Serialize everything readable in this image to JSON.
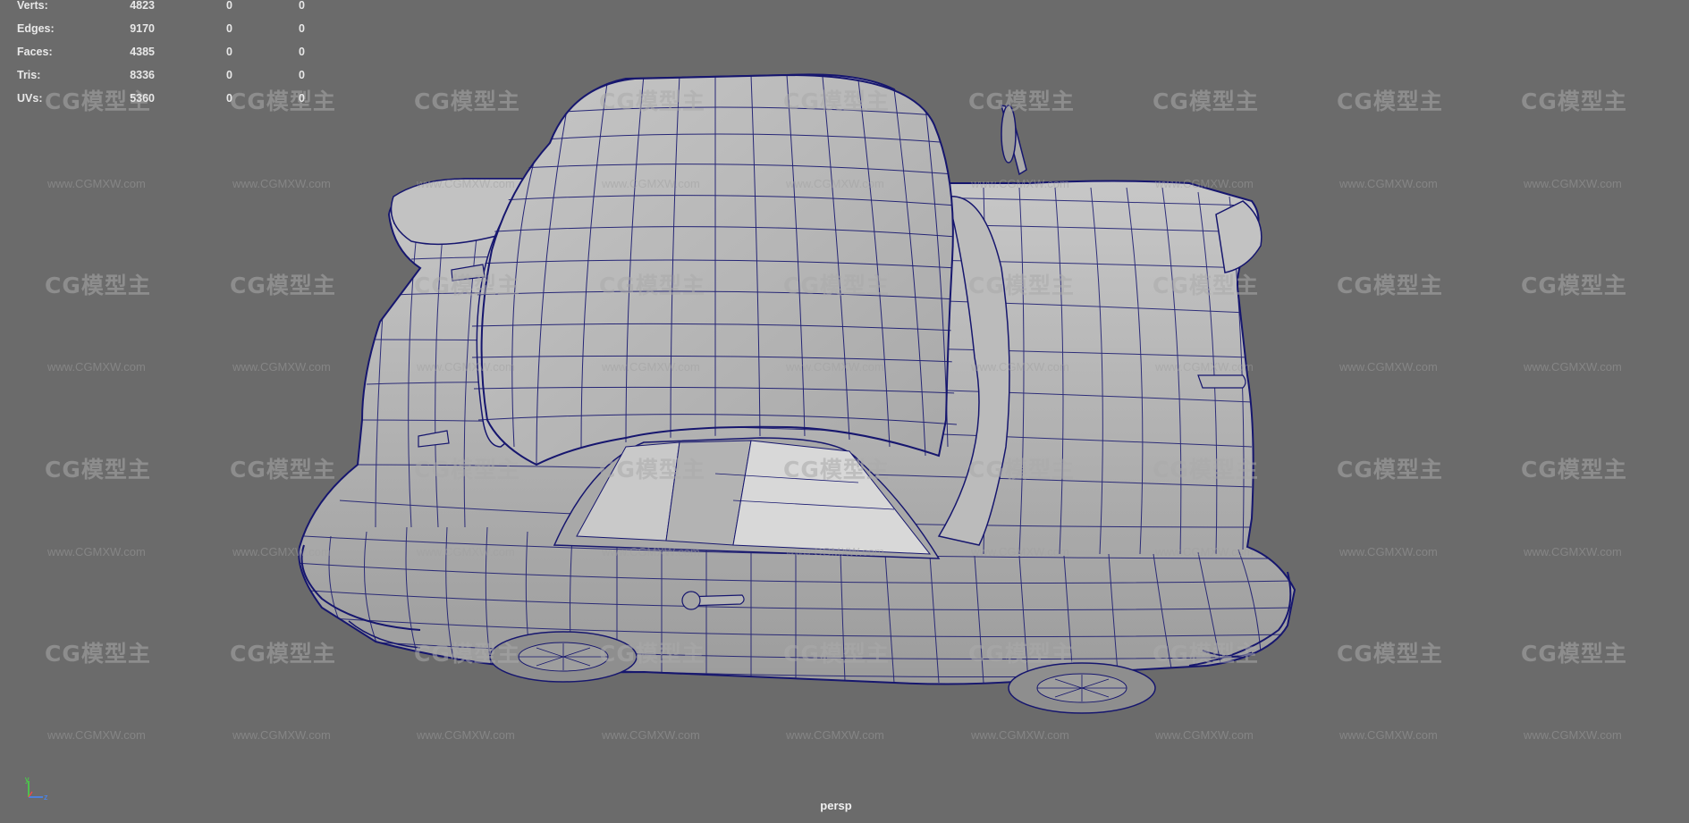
{
  "stats": {
    "rows": [
      {
        "label": "Verts:",
        "values": [
          "4823",
          "0",
          "0"
        ]
      },
      {
        "label": "Edges:",
        "values": [
          "9170",
          "0",
          "0"
        ]
      },
      {
        "label": "Faces:",
        "values": [
          "4385",
          "0",
          "0"
        ]
      },
      {
        "label": "Tris:",
        "values": [
          "8336",
          "0",
          "0"
        ]
      },
      {
        "label": "UVs:",
        "values": [
          "5360",
          "0",
          "0"
        ]
      }
    ]
  },
  "viewport": {
    "camera": "persp",
    "axis": {
      "y": "y",
      "z": "z"
    }
  },
  "watermark": {
    "logo": "CG模型主",
    "url": "www.CGMXW.com"
  },
  "colors": {
    "background": "#6b6b6b",
    "wireframe": "#16166e",
    "surface": "#bdbdbd"
  }
}
